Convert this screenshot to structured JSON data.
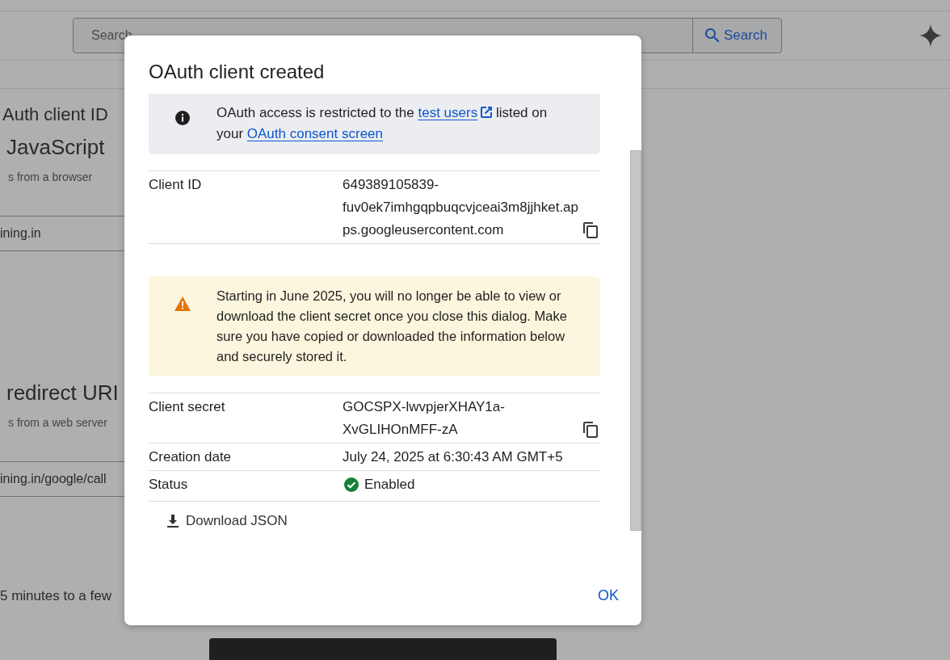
{
  "header": {
    "search_placeholder": "Search",
    "search_button": "Search"
  },
  "page": {
    "title": "Auth client ID",
    "sections": [
      {
        "heading": "JavaScript",
        "hint": "s from a browser",
        "value": "ining.in"
      },
      {
        "heading": "redirect URI",
        "hint": "s from a web server",
        "value": "ining.in/google/call"
      }
    ],
    "note": "5 minutes to a few"
  },
  "dialog": {
    "title": "OAuth client created",
    "info": [
      {
        "kind": "text",
        "text": "OAuth access is restricted to the "
      },
      {
        "kind": "link",
        "text": "test users",
        "external": true
      },
      {
        "kind": "text",
        "text": " listed on your "
      },
      {
        "kind": "link",
        "text": "OAuth consent screen",
        "external": false
      }
    ],
    "details": [
      {
        "kind": "text",
        "label": "Client ID",
        "value": "649389105839-fuv0ek7imhgqpbuqcvjceai3m8jjhket.apps.googleusercontent.com",
        "copyable": true
      }
    ],
    "warning": "Starting in June 2025, you will no longer be able to view or download the client secret once you close this dialog. Make sure you have copied or downloaded the information below and securely stored it.",
    "secrets": [
      {
        "kind": "text",
        "label": "Client secret",
        "value": "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",
        "copyable": true
      },
      {
        "kind": "text",
        "label": "Creation date",
        "value": "July 24, 2025 at 6:30:43 AM GMT+5",
        "copyable": false
      },
      {
        "kind": "status",
        "label": "Status",
        "value": "Enabled",
        "copyable": false
      }
    ],
    "download": "Download JSON",
    "ok": "OK"
  }
}
